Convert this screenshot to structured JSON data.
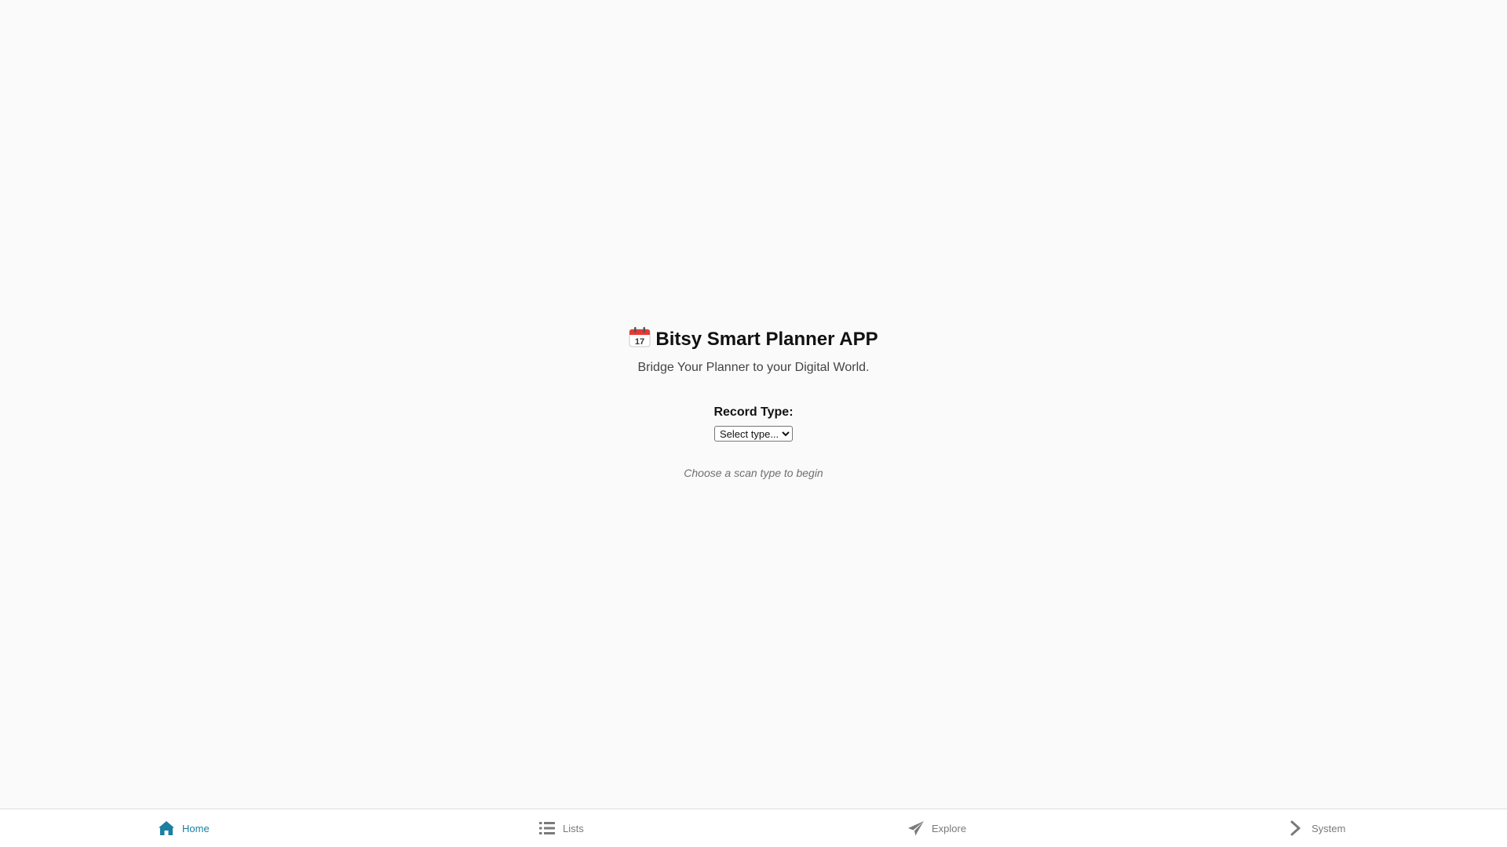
{
  "app": {
    "title": "Bitsy Smart Planner APP",
    "title_icon": "calendar-icon",
    "subtitle": "Bridge Your Planner to your Digital World."
  },
  "form": {
    "record_type_label": "Record Type:",
    "record_type_selected": "Select type...",
    "hint": "Choose a scan type to begin"
  },
  "nav": {
    "accent_color": "#1a7fa0",
    "inactive_color": "#7a7a7a",
    "items": [
      {
        "label": "Home",
        "icon": "home-icon",
        "active": true
      },
      {
        "label": "Lists",
        "icon": "list-icon",
        "active": false
      },
      {
        "label": "Explore",
        "icon": "paper-plane-icon",
        "active": false
      },
      {
        "label": "System",
        "icon": "chevron-right-icon",
        "active": false
      }
    ]
  }
}
